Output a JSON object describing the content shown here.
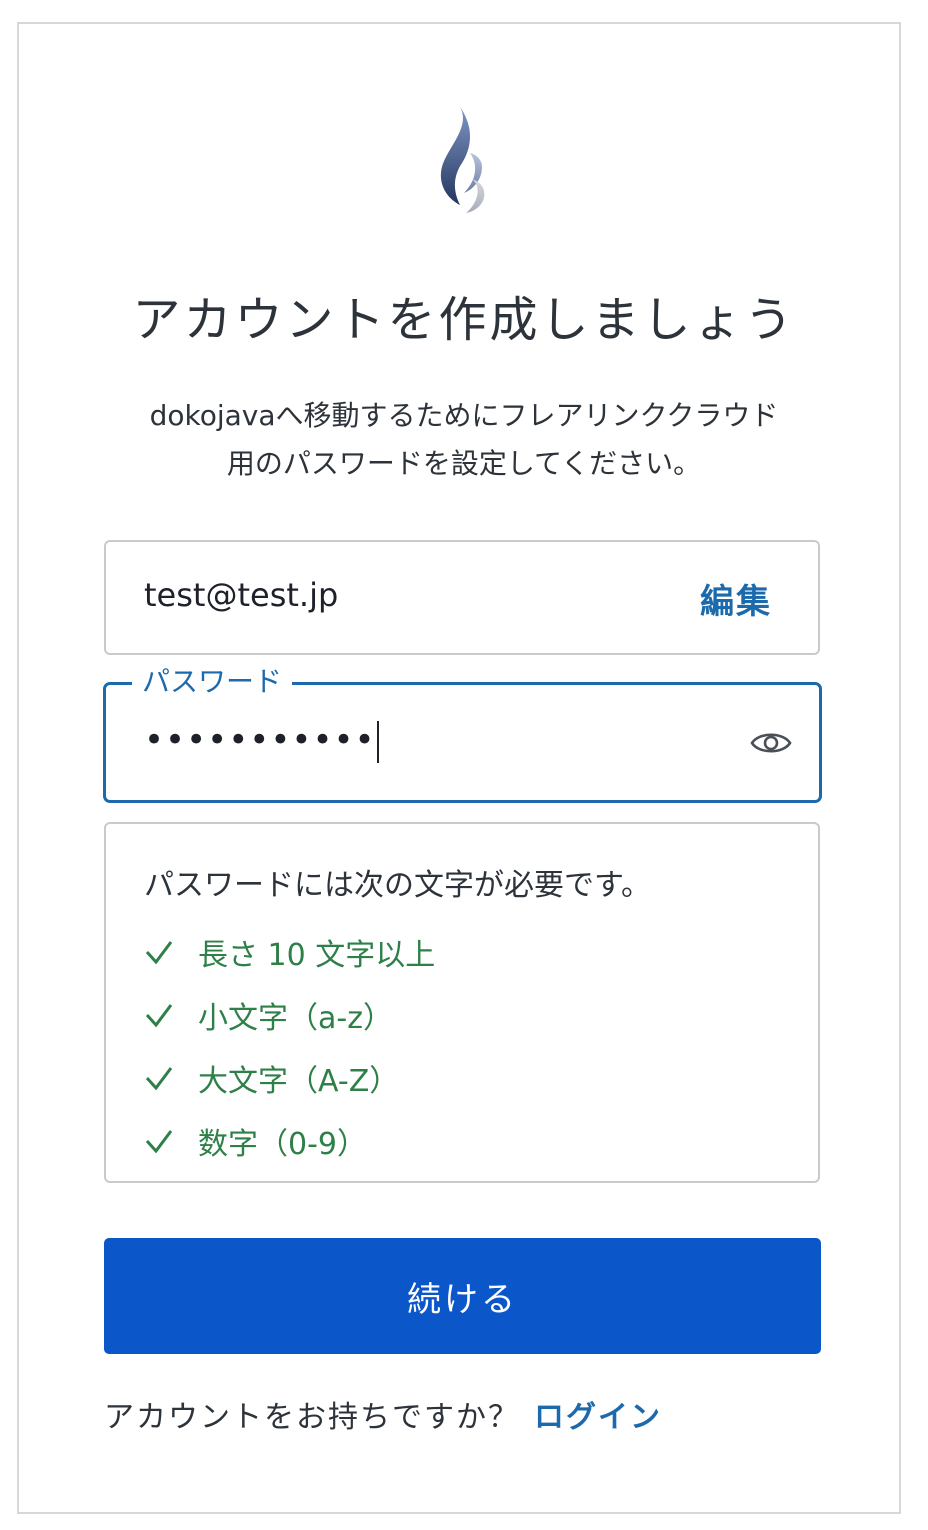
{
  "header": {
    "logo_icon": "flame-logo-icon",
    "title": "アカウントを作成しましょう",
    "description_line1": "dokojavaへ移動するためにフレアリンククラウド",
    "description_line2": "用のパスワードを設定してください。"
  },
  "email": {
    "value": "test@test.jp",
    "edit_label": "編集"
  },
  "password": {
    "label": "パスワード",
    "masked_value": "•••••••••••",
    "toggle_icon": "eye-icon"
  },
  "requirements": {
    "heading": "パスワードには次の文字が必要です。",
    "items": [
      {
        "label": "長さ 10 文字以上",
        "met": true
      },
      {
        "label": "小文字（a-z）",
        "met": true
      },
      {
        "label": "大文字（A-Z）",
        "met": true
      },
      {
        "label": "数字（0-9）",
        "met": true
      }
    ],
    "check_color": "#2e8048"
  },
  "actions": {
    "continue_label": "続ける"
  },
  "footer": {
    "prompt": "アカウントをお持ちですか？",
    "login_label": "ログイン"
  },
  "colors": {
    "accent": "#1c6aab",
    "primary_button": "#0b57c9"
  }
}
